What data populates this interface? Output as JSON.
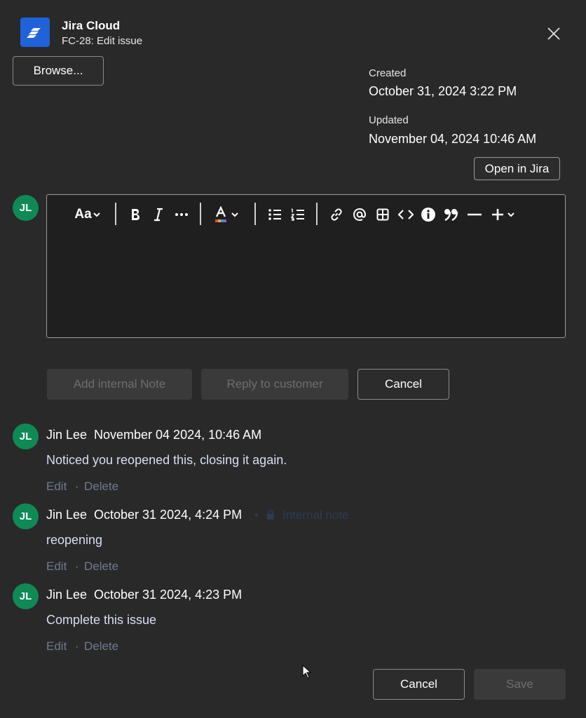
{
  "header": {
    "app_name": "Jira Cloud",
    "subtitle": "FC-28: Edit issue",
    "logo_icon": "jira-logo-icon",
    "close_icon": "close-icon"
  },
  "browse_button": "Browse...",
  "meta": {
    "created_label": "Created",
    "created_value": "October 31, 2024 3:22 PM",
    "updated_label": "Updated",
    "updated_value": "November 04, 2024 10:46 AM"
  },
  "open_in_jira": "Open in Jira",
  "current_user_initials": "JL",
  "toolbar": {
    "text_style_label": "Aa",
    "icons": [
      "text-style-icon",
      "bold-icon",
      "italic-icon",
      "more-formatting-icon",
      "text-color-icon",
      "bullet-list-icon",
      "numbered-list-icon",
      "link-icon",
      "mention-icon",
      "table-icon",
      "code-icon",
      "info-panel-icon",
      "quote-icon",
      "divider-icon",
      "insert-icon"
    ]
  },
  "composer_actions": {
    "add_note": "Add internal Note",
    "reply": "Reply to customer",
    "cancel": "Cancel"
  },
  "comments": [
    {
      "initials": "JL",
      "author": "Jin Lee",
      "date": "November 04 2024, 10:46 AM",
      "body": "Noticed you reopened this, closing it again.",
      "edit": "Edit",
      "delete": "Delete",
      "separator": "·"
    },
    {
      "initials": "JL",
      "author": "Jin Lee",
      "date": "October 31 2024, 4:24 PM",
      "internal_label": "Internal note",
      "internal_dot": "•",
      "body": "reopening",
      "edit": "Edit",
      "delete": "Delete",
      "separator": "·"
    },
    {
      "initials": "JL",
      "author": "Jin Lee",
      "date": "October 31 2024, 4:23 PM",
      "body": "Complete this issue",
      "edit": "Edit",
      "delete": "Delete",
      "separator": "·"
    }
  ],
  "footer": {
    "cancel": "Cancel",
    "save": "Save"
  },
  "colors": {
    "background": "#292929",
    "accent_logo": "#1f62d9",
    "avatar": "#0f8a55",
    "muted_link": "#6f7a93"
  }
}
